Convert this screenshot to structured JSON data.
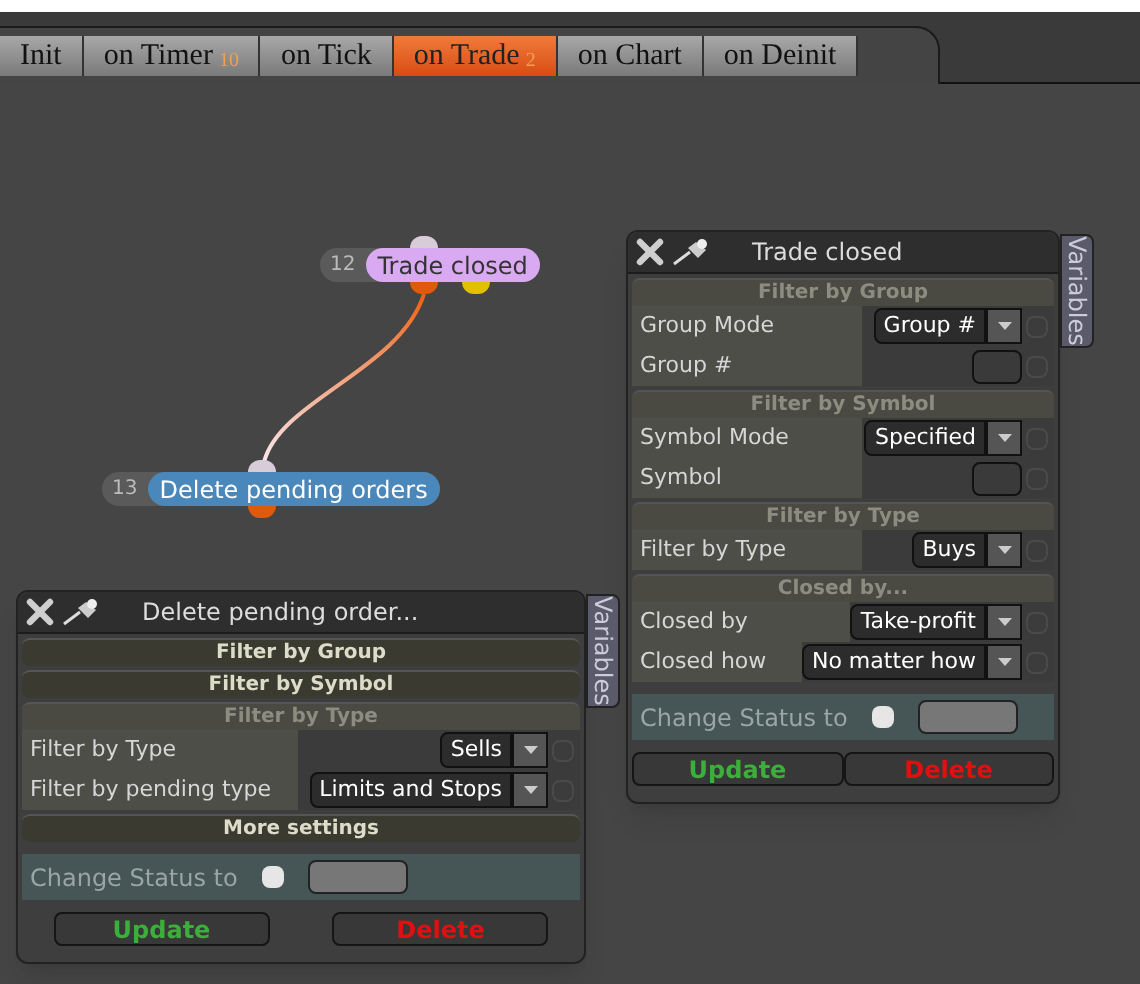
{
  "tabs": [
    {
      "label": "Init",
      "selected": false
    },
    {
      "label": "on Timer",
      "badge": "10",
      "selected": false
    },
    {
      "label": "on Tick",
      "selected": false
    },
    {
      "label": "on Trade",
      "badge": "2",
      "selected": true
    },
    {
      "label": "on Chart",
      "selected": false
    },
    {
      "label": "on Deinit",
      "selected": false
    }
  ],
  "nodes": [
    {
      "number": "12",
      "label": "Trade closed",
      "color": "#d9a9f2"
    },
    {
      "number": "13",
      "label": "Delete pending orders",
      "color": "#4a87ba"
    }
  ],
  "panels": [
    {
      "title": "Trade closed",
      "side_tab": "Variables",
      "sections": [
        {
          "title": "Filter by Group",
          "expanded": true,
          "rows": [
            {
              "label": "Group Mode",
              "kind": "dropdown",
              "value": "Group #",
              "checked": false
            },
            {
              "label": "Group #",
              "kind": "field",
              "checked": false
            }
          ]
        },
        {
          "title": "Filter by Symbol",
          "expanded": true,
          "rows": [
            {
              "label": "Symbol Mode",
              "kind": "dropdown",
              "value": "Specified",
              "checked": false
            },
            {
              "label": "Symbol",
              "kind": "field",
              "checked": false
            }
          ]
        },
        {
          "title": "Filter by Type",
          "expanded": true,
          "rows": [
            {
              "label": "Filter by Type",
              "kind": "dropdown",
              "value": "Buys",
              "checked": false
            }
          ]
        },
        {
          "title": "Closed by...",
          "expanded": true,
          "rows": [
            {
              "label": "Closed by",
              "kind": "dropdown",
              "value": "Take-profit",
              "checked": false
            },
            {
              "label": "Closed how",
              "kind": "dropdown",
              "value": "No matter how",
              "checked": false
            }
          ]
        }
      ],
      "change_status": {
        "label": "Change Status to",
        "checked": false
      },
      "buttons": [
        {
          "label": "Update",
          "kind": "update"
        },
        {
          "label": "Delete",
          "kind": "delete"
        }
      ]
    },
    {
      "title": "Delete pending order...",
      "side_tab": "Variables",
      "sections": [
        {
          "title": "Filter by Group",
          "expanded": false
        },
        {
          "title": "Filter by Symbol",
          "expanded": false
        },
        {
          "title": "Filter by Type",
          "expanded": true,
          "rows": [
            {
              "label": "Filter by Type",
              "kind": "dropdown",
              "value": "Sells",
              "checked": false
            },
            {
              "label": "Filter by pending type",
              "kind": "dropdown",
              "value": "Limits and Stops",
              "checked": false
            }
          ]
        },
        {
          "title": "More settings",
          "expanded": false
        }
      ],
      "change_status": {
        "label": "Change Status to",
        "checked": false
      },
      "buttons": [
        {
          "label": "Update",
          "kind": "update"
        },
        {
          "label": "Delete",
          "kind": "delete"
        }
      ]
    }
  ]
}
